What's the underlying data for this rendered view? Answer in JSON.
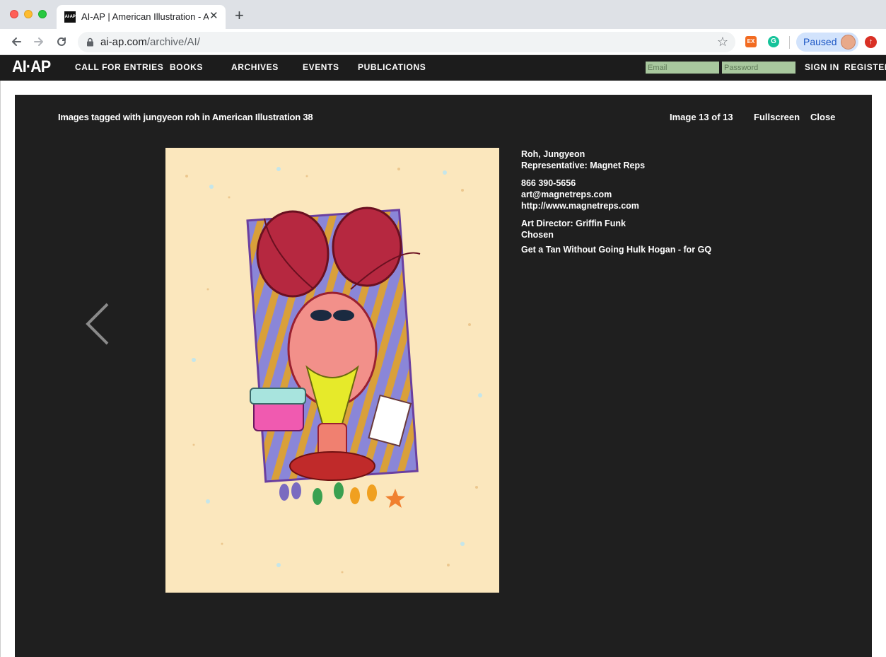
{
  "browser": {
    "tab_title": "AI-AP | American Illustration - A",
    "tab_favicon_text": "AI·AP",
    "url_host": "ai-ap.com",
    "url_path": "/archive/AI/",
    "extension_ex_label": "EX",
    "extension_g_label": "G",
    "profile_status": "Paused"
  },
  "site": {
    "logo": "AI·AP",
    "nav": {
      "call_for_entries": "CALL FOR ENTRIES",
      "books": "BOOKS",
      "archives": "ARCHIVES",
      "events": "EVENTS",
      "publications": "PUBLICATIONS"
    },
    "email_placeholder": "Email",
    "password_placeholder": "Password",
    "sign_in": "SIGN IN",
    "register": "REGISTER"
  },
  "lightbox": {
    "caption": "Images tagged with jungyeon roh in American Illustration 38",
    "counter": "Image 13 of 13",
    "fullscreen": "Fullscreen",
    "close": "Close",
    "info": {
      "artist": "Roh, Jungyeon",
      "representative": "Representative: Magnet Reps",
      "phone": "866 390-5656",
      "email": "art@magnetreps.com",
      "website": "http://www.magnetreps.com",
      "art_director": "Art Director: Griffin Funk",
      "client": "Chosen",
      "title": "Get a Tan Without Going Hulk Hogan - for GQ"
    }
  }
}
